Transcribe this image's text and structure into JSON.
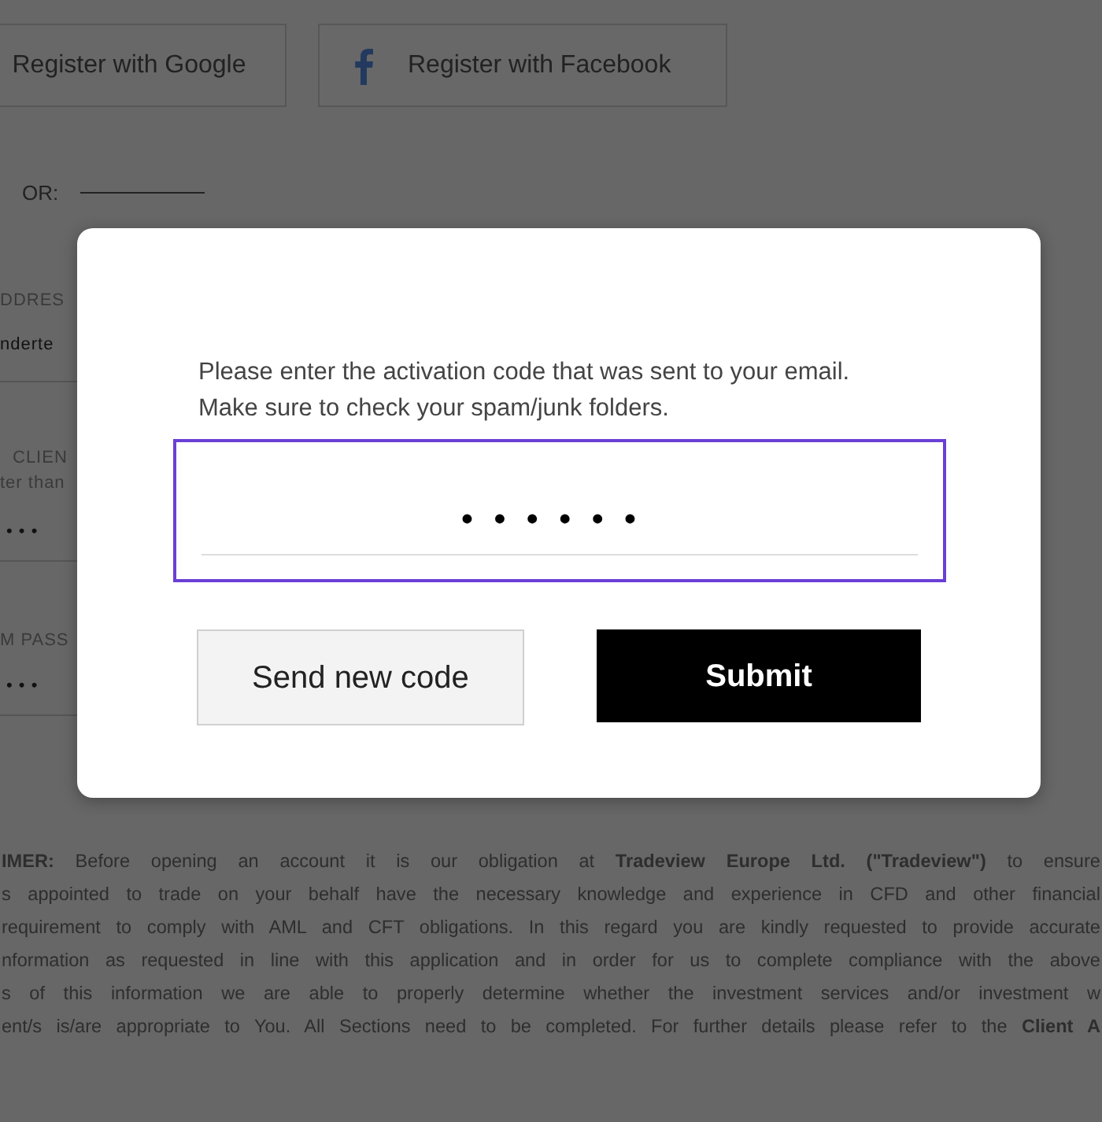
{
  "social_buttons": [
    {
      "kind": "google",
      "label": "Register with Google"
    },
    {
      "kind": "facebook",
      "label": "Register with Facebook"
    }
  ],
  "divider_label": "OR:",
  "form_fields": [
    {
      "label": "DDRES",
      "value": "nderte"
    },
    {
      "label": "CLIEN",
      "hint": "ter than",
      "value": "• • •"
    },
    {
      "label": "M PASS",
      "value": "• • •"
    }
  ],
  "disclaimer_lines": [
    "**IMER:** Before opening an account it is our obligation at **Tradeview Europe Ltd. (\"Tradeview\")** to ensure",
    "s appointed to trade on your behalf have the necessary knowledge and experience in CFD and other financial",
    " requirement to comply with AML and CFT obligations. In this regard you are kindly requested to provide accurate",
    "nformation as requested in line with this application and in order for us to complete compliance with the above",
    "s of this information we are able to properly determine whether the investment services and/or investment w",
    "ent/s is/are appropriate to You. All Sections need to be completed. For further details please refer to the **Client A**"
  ],
  "dialog": {
    "message": "Please enter the activation code that was sent to your email.\nMake sure to check your spam/junk folders.",
    "code": {
      "value": "••••••",
      "focused": true
    },
    "buttons": [
      {
        "kind": "secondary",
        "label": "Send new code"
      },
      {
        "kind": "primary",
        "label": "Submit"
      }
    ]
  }
}
